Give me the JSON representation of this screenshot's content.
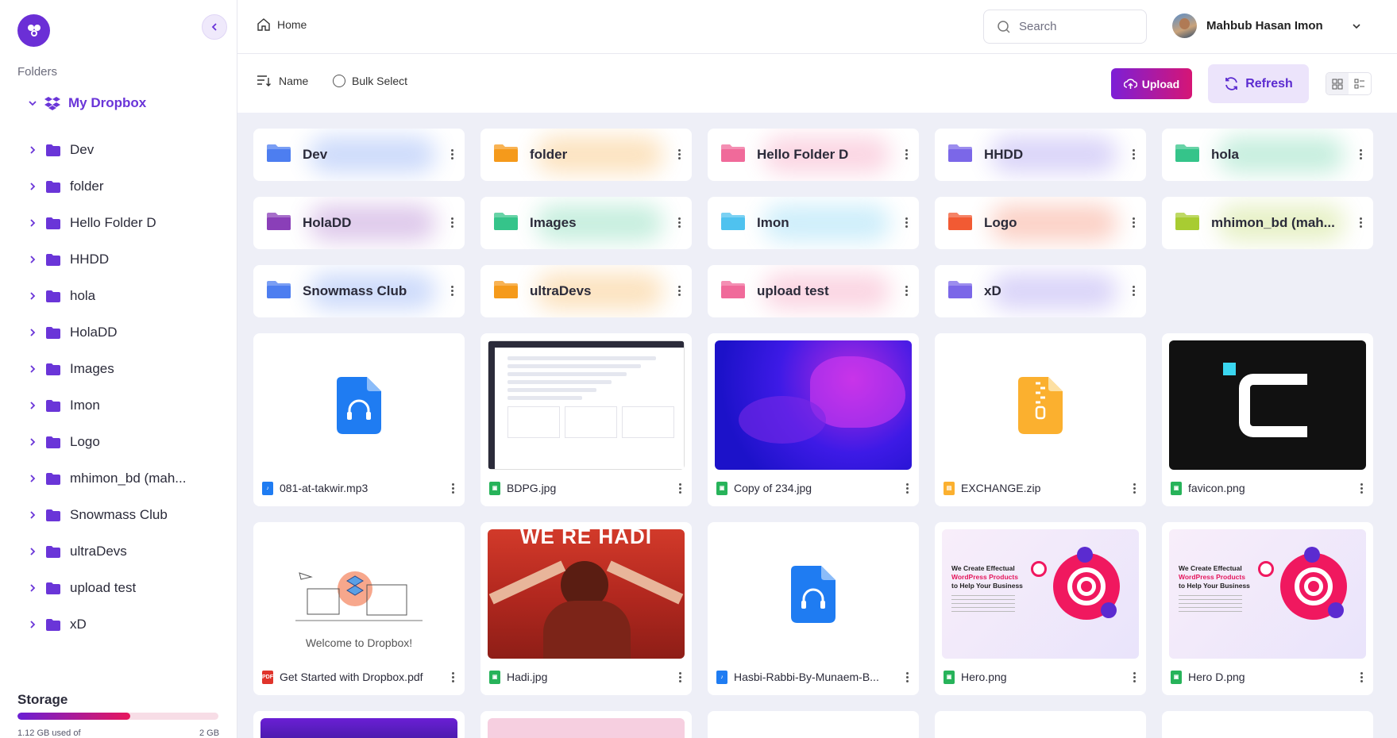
{
  "sidebar": {
    "folders_heading": "Folders",
    "root": "My Dropbox",
    "items": [
      "Dev",
      "folder",
      "Hello Folder D",
      "HHDD",
      "hola",
      "HolaDD",
      "Images",
      "Imon",
      "Logo",
      "mhimon_bd (mah...",
      "Snowmass Club",
      "ultraDevs",
      "upload test",
      "xD"
    ],
    "storage": {
      "title": "Storage",
      "used_label": "1.12 GB used of",
      "total_label": "2 GB",
      "used_fraction": 0.56
    }
  },
  "header": {
    "breadcrumb": "Home",
    "search_placeholder": "Search",
    "user_name": "Mahbub Hasan Imon"
  },
  "toolbar": {
    "sort_label": "Name",
    "bulk_label": "Bulk Select",
    "upload_label": "Upload",
    "refresh_label": "Refresh"
  },
  "folders": [
    {
      "name": "Dev",
      "color": "#4d7ef0"
    },
    {
      "name": "folder",
      "color": "#f59a1b"
    },
    {
      "name": "Hello Folder D",
      "color": "#f06a9a"
    },
    {
      "name": "HHDD",
      "color": "#7b67e8"
    },
    {
      "name": "hola",
      "color": "#35c48a"
    },
    {
      "name": "HolaDD",
      "color": "#8a3fb8"
    },
    {
      "name": "Images",
      "color": "#35c48a"
    },
    {
      "name": "Imon",
      "color": "#4fc2ef"
    },
    {
      "name": "Logo",
      "color": "#f25a33"
    },
    {
      "name": "mhimon_bd (mah...",
      "color": "#a8cc32"
    },
    {
      "name": "Snowmass Club",
      "color": "#4d7ef0"
    },
    {
      "name": "ultraDevs",
      "color": "#f59a1b"
    },
    {
      "name": "upload test",
      "color": "#f06a9a"
    },
    {
      "name": "xD",
      "color": "#7b67e8"
    }
  ],
  "files": [
    {
      "name": "081-at-takwir.mp3",
      "type": "audio"
    },
    {
      "name": "BDPG.jpg",
      "type": "image"
    },
    {
      "name": "Copy of 234.jpg",
      "type": "image"
    },
    {
      "name": "EXCHANGE.zip",
      "type": "zip"
    },
    {
      "name": "favicon.png",
      "type": "image"
    },
    {
      "name": "Get Started with Dropbox.pdf",
      "type": "pdf",
      "preview_text": "Welcome to Dropbox!"
    },
    {
      "name": "Hadi.jpg",
      "type": "image",
      "preview_text": "WE RE HADI"
    },
    {
      "name": "Hasbi-Rabbi-By-Munaem-B...",
      "type": "audio"
    },
    {
      "name": "Hero.png",
      "type": "image",
      "preview_lines": [
        "We Create Effectual",
        "WordPress Products",
        "to Help Your Business"
      ]
    },
    {
      "name": "Hero D.png",
      "type": "image",
      "preview_lines": [
        "We Create Effectual",
        "WordPress Products",
        "to Help Your Business"
      ]
    }
  ],
  "colors": {
    "accent": "#6a35d8",
    "upload_gradient_start": "#7c1fd6",
    "upload_gradient_end": "#d61575"
  }
}
